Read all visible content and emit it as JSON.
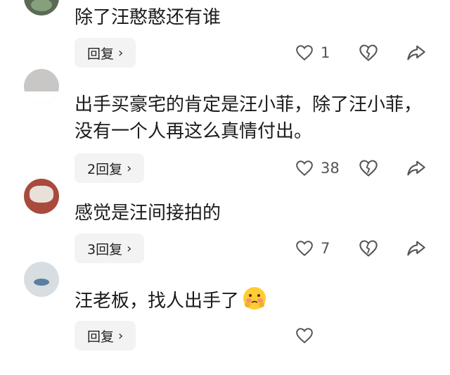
{
  "comments": [
    {
      "text": "除了汪憨憨还有谁",
      "reply_label": "回复",
      "like_count": "1",
      "has_dislike": true,
      "has_share": true
    },
    {
      "text": "出手买豪宅的肯定是汪小菲，除了汪小菲，没有一个人再这么真情付出。",
      "reply_label": "2回复",
      "like_count": "38",
      "has_dislike": true,
      "has_share": true
    },
    {
      "text": "感觉是汪间接拍的",
      "reply_label": "3回复",
      "like_count": "7",
      "has_dislike": true,
      "has_share": true
    },
    {
      "text": "汪老板，找人出手了",
      "reply_label": "回复",
      "like_count": "",
      "has_dislike": false,
      "has_share": false
    }
  ],
  "icons": {
    "like": "heart-icon",
    "dislike": "broken-heart-icon",
    "share": "share-arrow-icon",
    "reply_chevron": "chevron-right-icon",
    "emoji": "shy-face-emoji"
  },
  "colors": {
    "reply_bg": "#f3f3f3",
    "icon": "#555555",
    "text": "#1b1b1b"
  }
}
